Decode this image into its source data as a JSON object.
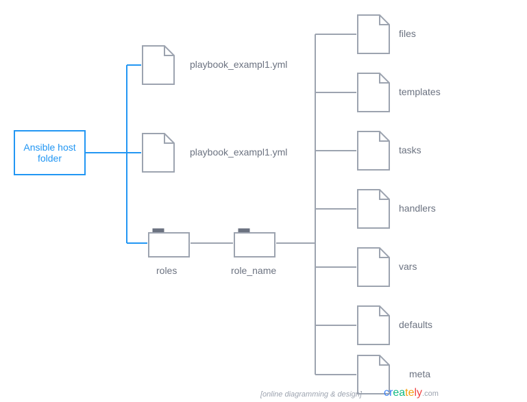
{
  "root": {
    "label": "Ansible host folder"
  },
  "files": {
    "playbook1": "playbook_exampl1.yml",
    "playbook2": "playbook_exampl1.yml"
  },
  "folders": {
    "roles": "roles",
    "role_name": "role_name"
  },
  "role_files": {
    "files": "files",
    "templates": "templates",
    "tasks": "tasks",
    "handlers": "handlers",
    "vars": "vars",
    "defaults": "defaults",
    "meta": "meta"
  },
  "footer": "[online diagramming & design]",
  "brand": {
    "name": "creately",
    "suffix": ".com"
  },
  "colors": {
    "accent": "#2196f3",
    "line_gray": "#9ca3af",
    "text_gray": "#6b7280"
  }
}
